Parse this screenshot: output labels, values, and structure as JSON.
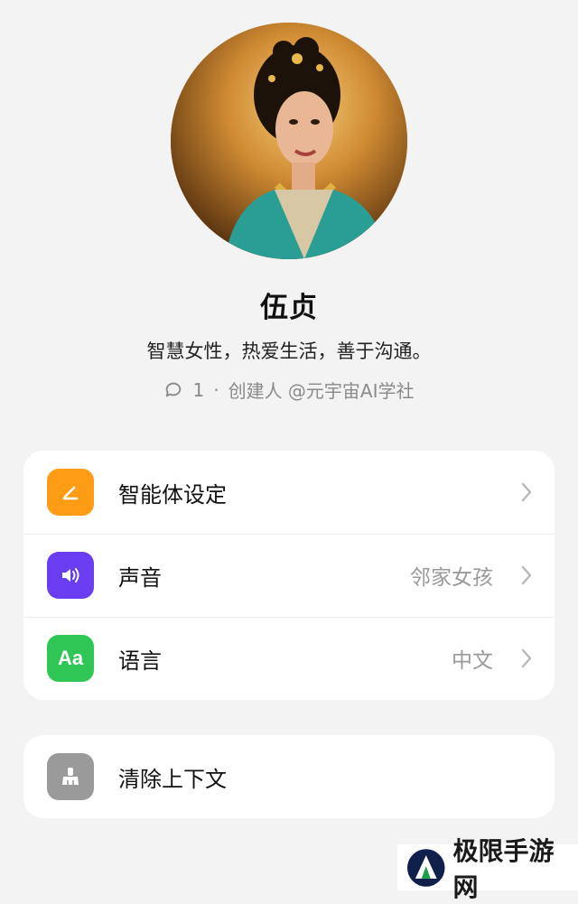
{
  "profile": {
    "name": "伍贞",
    "description": "智慧女性，热爱生活，善于沟通。",
    "comment_count": "1",
    "separator": "·",
    "creator": "创建人 @元宇宙AI学社"
  },
  "settings": [
    {
      "label": "智能体设定",
      "value": "",
      "icon": "pencil-icon",
      "color": "#ff9c16"
    },
    {
      "label": "声音",
      "value": "邻家女孩",
      "icon": "speaker-icon",
      "color": "#6a3df0"
    },
    {
      "label": "语言",
      "value": "中文",
      "icon": "Aa",
      "color": "#2fc655"
    }
  ],
  "actions": [
    {
      "label": "清除上下文",
      "icon": "broom-icon",
      "color": "#9a9a9a"
    }
  ],
  "watermark": {
    "text": "极限手游网"
  }
}
